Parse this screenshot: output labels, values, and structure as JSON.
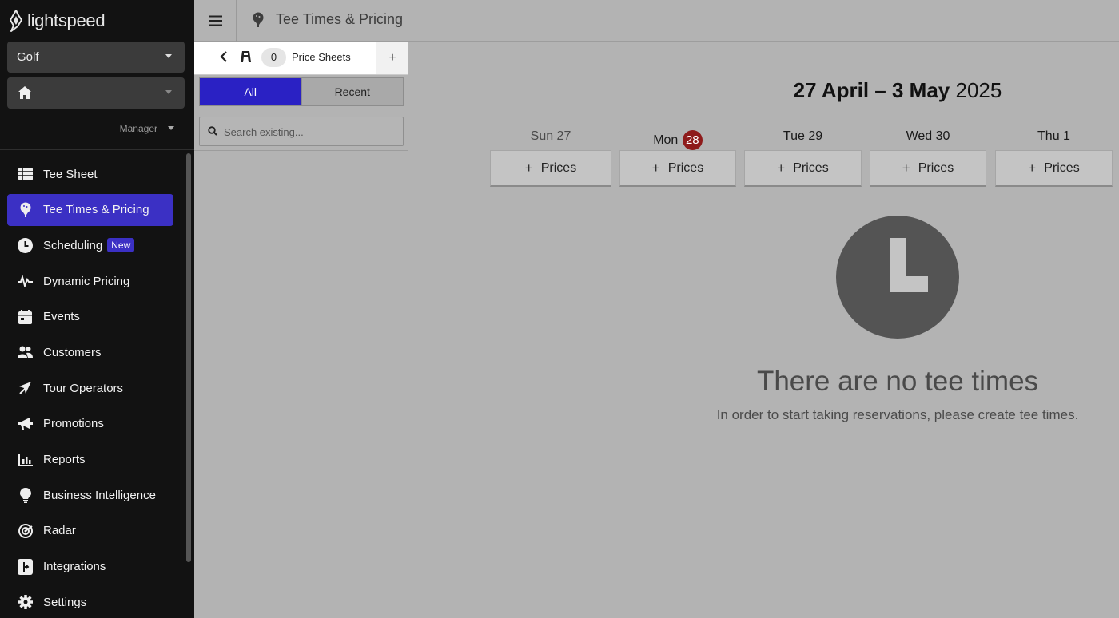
{
  "brand": {
    "name": "lightspeed"
  },
  "sidebar": {
    "course_select": "Golf",
    "location_select": "",
    "role": "Manager",
    "items": [
      {
        "label": "Tee Sheet",
        "icon": "table-icon",
        "active": false
      },
      {
        "label": "Tee Times & Pricing",
        "icon": "golf-tee-icon",
        "active": true
      },
      {
        "label": "Scheduling",
        "icon": "clock-icon",
        "active": false,
        "badge": "New"
      },
      {
        "label": "Dynamic Pricing",
        "icon": "pulse-icon",
        "active": false
      },
      {
        "label": "Events",
        "icon": "calendar-icon",
        "active": false
      },
      {
        "label": "Customers",
        "icon": "users-icon",
        "active": false
      },
      {
        "label": "Tour Operators",
        "icon": "plane-icon",
        "active": false
      },
      {
        "label": "Promotions",
        "icon": "megaphone-icon",
        "active": false
      },
      {
        "label": "Reports",
        "icon": "bar-chart-icon",
        "active": false
      },
      {
        "label": "Business Intelligence",
        "icon": "lightbulb-icon",
        "active": false
      },
      {
        "label": "Radar",
        "icon": "radar-icon",
        "active": false
      },
      {
        "label": "Integrations",
        "icon": "integrations-icon",
        "active": false
      },
      {
        "label": "Settings",
        "icon": "gear-icon",
        "active": false
      }
    ]
  },
  "header": {
    "title": "Tee Times & Pricing"
  },
  "price_sheets": {
    "count": "0",
    "label": "Price Sheets",
    "add": "+",
    "tabs": {
      "all": "All",
      "recent": "Recent"
    },
    "search_placeholder": "Search existing..."
  },
  "calendar": {
    "range_bold": "27 April – 3 May",
    "range_year": "2025",
    "days": [
      {
        "name": "Sun 27",
        "past": true
      },
      {
        "name": "Mon",
        "today_num": "28",
        "past": false
      },
      {
        "name": "Tue 29",
        "past": false
      },
      {
        "name": "Wed 30",
        "past": false
      },
      {
        "name": "Thu 1",
        "past": false
      }
    ],
    "prices_label": "Prices",
    "plus": "+"
  },
  "empty_state": {
    "title": "There are no tee times",
    "subtitle": "In order to start taking reservations, please create tee times."
  },
  "colors": {
    "accent": "#3b30c4",
    "sidebar_bg": "#121212",
    "today_badge": "#8e1b1b"
  }
}
